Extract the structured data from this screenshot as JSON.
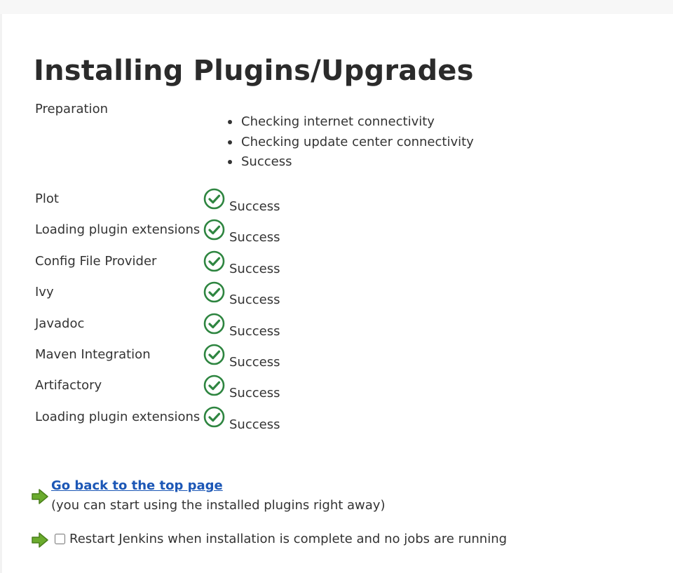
{
  "page": {
    "title": "Installing Plugins/Upgrades"
  },
  "preparation": {
    "label": "Preparation",
    "steps": [
      "Checking internet connectivity",
      "Checking update center connectivity",
      "Success"
    ]
  },
  "plugins": [
    {
      "name": "Plot",
      "status": "Success",
      "icon": "success-check-icon"
    },
    {
      "name": "Loading plugin extensions",
      "status": "Success",
      "icon": "success-check-icon"
    },
    {
      "name": "Config File Provider",
      "status": "Success",
      "icon": "success-check-icon"
    },
    {
      "name": "Ivy",
      "status": "Success",
      "icon": "success-check-icon"
    },
    {
      "name": "Javadoc",
      "status": "Success",
      "icon": "success-check-icon"
    },
    {
      "name": "Maven Integration",
      "status": "Success",
      "icon": "success-check-icon"
    },
    {
      "name": "Artifactory",
      "status": "Success",
      "icon": "success-check-icon"
    },
    {
      "name": "Loading plugin extensions",
      "status": "Success",
      "icon": "success-check-icon"
    }
  ],
  "actions": {
    "top_link": "Go back to the top page",
    "top_note": "(you can start using the installed plugins right away)",
    "restart_label": "Restart Jenkins when installation is complete and no jobs are running",
    "restart_checked": false
  },
  "colors": {
    "success": "#2e8540",
    "link": "#1c57b6",
    "arrow": "#6aab2d"
  }
}
